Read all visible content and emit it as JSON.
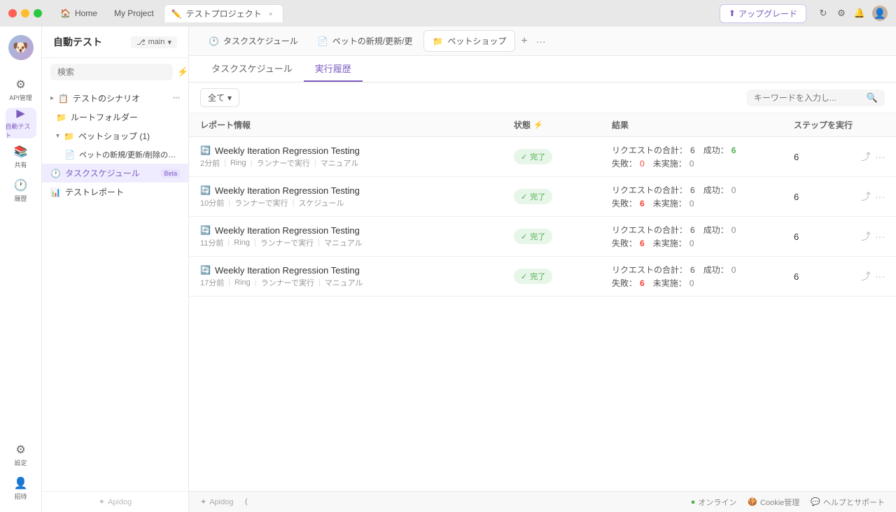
{
  "titlebar": {
    "tabs": [
      {
        "id": "home",
        "label": "Home",
        "icon": "🏠",
        "active": false,
        "closable": false
      },
      {
        "id": "project",
        "label": "My Project",
        "icon": "",
        "active": false,
        "closable": false
      },
      {
        "id": "test",
        "label": "テストプロジェクト",
        "icon": "✏️",
        "active": true,
        "closable": true
      }
    ],
    "upgrade_label": "アップグレード",
    "icons": [
      "refresh",
      "settings",
      "bell",
      "avatar"
    ]
  },
  "icon_sidebar": {
    "items": [
      {
        "id": "dog",
        "icon": "🐶",
        "label": "",
        "type": "avatar",
        "active": false
      },
      {
        "id": "api",
        "icon": "⚙",
        "label": "API管理",
        "active": false
      },
      {
        "id": "autotest",
        "icon": "▶",
        "label": "自動テスト",
        "active": true
      },
      {
        "id": "shared",
        "icon": "📚",
        "label": "共有",
        "active": false
      },
      {
        "id": "history",
        "icon": "🕐",
        "label": "履歴",
        "active": false
      },
      {
        "id": "settings",
        "icon": "⚙",
        "label": "設定",
        "active": false
      }
    ],
    "bottom_items": [
      {
        "id": "invite",
        "icon": "👤+",
        "label": "招待",
        "active": false
      }
    ]
  },
  "nav_sidebar": {
    "project_title": "自動テスト",
    "branch": "main",
    "search_placeholder": "検索",
    "tree": [
      {
        "id": "scenarios",
        "label": "テストのシナリオ",
        "icon": "📋",
        "indent": 0,
        "has_arrow": true,
        "arrow": "▸",
        "badge": null
      },
      {
        "id": "root_folder",
        "label": "ルートフォルダー",
        "icon": "📁",
        "indent": 1,
        "has_arrow": false,
        "badge": null
      },
      {
        "id": "pet_shop",
        "label": "ペットショップ (1)",
        "icon": "📁",
        "indent": 1,
        "has_arrow": true,
        "arrow": "▾",
        "badge": null
      },
      {
        "id": "pet_flow",
        "label": "ペットの新規/更新/削除の流れ",
        "icon": "📄",
        "indent": 2,
        "has_arrow": false,
        "badge": null
      },
      {
        "id": "task_schedule",
        "label": "タスクスケジュール",
        "icon": "🕐",
        "indent": 0,
        "has_arrow": false,
        "badge": "Beta",
        "active": true
      },
      {
        "id": "test_report",
        "label": "テストレポート",
        "icon": "📊",
        "indent": 0,
        "has_arrow": false,
        "badge": null
      }
    ]
  },
  "top_tabs": [
    {
      "id": "task_schedule",
      "label": "タスクスケジュール",
      "icon": "🕐",
      "active": false
    },
    {
      "id": "pet_new",
      "label": "ペットの新規/更新/更",
      "icon": "📄",
      "active": false
    },
    {
      "id": "pet_shop",
      "label": "ペットショップ",
      "icon": "📁",
      "active": true
    }
  ],
  "sub_tabs": [
    {
      "id": "schedule",
      "label": "タスクスケジュール",
      "active": false
    },
    {
      "id": "history",
      "label": "実行履歴",
      "active": true
    }
  ],
  "filter": {
    "all_label": "全て",
    "arrow": "▾",
    "keyword_placeholder": "キーワードを入力し..."
  },
  "table": {
    "headers": [
      {
        "id": "report",
        "label": "レポート情報"
      },
      {
        "id": "status",
        "label": "状態"
      },
      {
        "id": "result",
        "label": "結果"
      },
      {
        "id": "steps",
        "label": "ステップを実行"
      }
    ],
    "rows": [
      {
        "id": "row1",
        "title": "Weekly Iteration Regression Testing",
        "icon": "🔄",
        "time": "2分前",
        "source": "Ring",
        "executor": "ランナーで実行",
        "trigger": "マニュアル",
        "status": "完了",
        "total": "6",
        "success": "6",
        "fail": "0",
        "na": "0",
        "success_color": "green",
        "fail_color": "normal",
        "steps": "6"
      },
      {
        "id": "row2",
        "title": "Weekly Iteration Regression Testing",
        "icon": "🔄",
        "time": "10分前",
        "source": "",
        "executor": "ランナーで実行",
        "trigger": "スケジュール",
        "status": "完了",
        "total": "6",
        "success": "0",
        "fail": "6",
        "na": "0",
        "success_color": "normal",
        "fail_color": "red",
        "steps": "6"
      },
      {
        "id": "row3",
        "title": "Weekly Iteration Regression Testing",
        "icon": "🔄",
        "time": "11分前",
        "source": "Ring",
        "executor": "ランナーで実行",
        "trigger": "マニュアル",
        "status": "完了",
        "total": "6",
        "success": "0",
        "fail": "6",
        "na": "0",
        "success_color": "normal",
        "fail_color": "red",
        "steps": "6"
      },
      {
        "id": "row4",
        "title": "Weekly Iteration Regression Testing",
        "icon": "🔄",
        "time": "17分前",
        "source": "Ring",
        "executor": "ランナーで実行",
        "trigger": "マニュアル",
        "status": "完了",
        "total": "6",
        "success": "0",
        "fail": "6",
        "na": "0",
        "success_color": "normal",
        "fail_color": "red",
        "steps": "6"
      }
    ],
    "result_labels": {
      "total": "リクエストの合計：",
      "success": "成功：",
      "fail": "失敗：",
      "na": "未実施："
    }
  },
  "footer": {
    "collapse_icon": "⟨",
    "brand": "Apidog",
    "online_label": "オンライン",
    "cookie_label": "Cookie管理",
    "help_label": "ヘルプとサポート"
  }
}
